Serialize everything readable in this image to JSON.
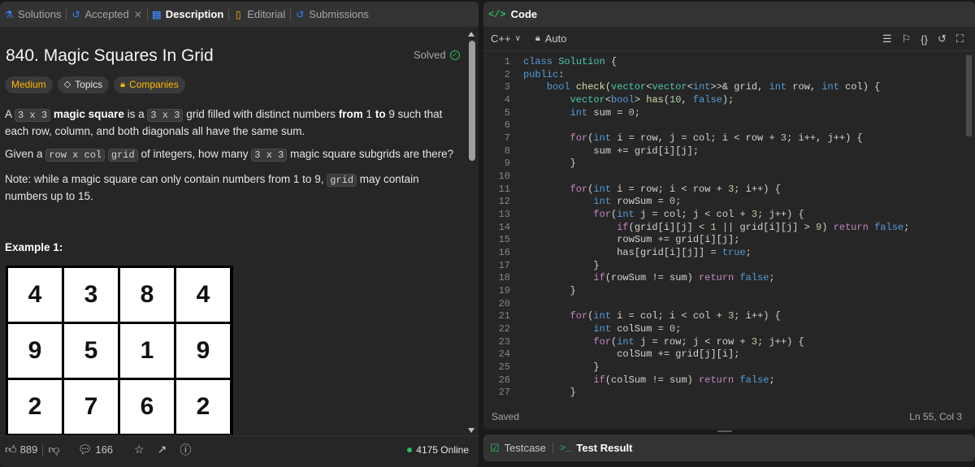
{
  "left_tabs": {
    "solutions": "Solutions",
    "accepted": "Accepted",
    "description": "Description",
    "editorial": "Editorial",
    "submissions": "Submissions"
  },
  "problem": {
    "title": "840. Magic Squares In Grid",
    "status": "Solved",
    "difficulty": "Medium",
    "topics_label": "Topics",
    "companies_label": "Companies",
    "desc": {
      "a": "A",
      "c3x3": "3 x 3",
      "magic": "magic square",
      "is_a": "is a",
      "grid_filled": "grid filled with distinct numbers",
      "from1": "from",
      "one": "1",
      "to": "to",
      "nine": "9",
      "rest": "such that each row, column, and both diagonals all have the same sum."
    },
    "q": {
      "given": "Given a",
      "rowxcol": "row x col",
      "grid": "grid",
      "of_int": "of integers, how many",
      "c3x3": "3 x 3",
      "rest": "magic square subgrids are there?"
    },
    "note": {
      "a": "Note: while a magic square can only contain numbers from 1 to 9,",
      "grid": "grid",
      "b": "may contain numbers up to 15."
    },
    "example_title": "Example 1:",
    "example_grid": [
      [
        "4",
        "3",
        "8",
        "4"
      ],
      [
        "9",
        "5",
        "1",
        "9"
      ],
      [
        "2",
        "7",
        "6",
        "2"
      ]
    ]
  },
  "left_footer": {
    "likes": "889",
    "comments": "166",
    "online": "4175 Online"
  },
  "code_panel": {
    "title": "Code",
    "language": "C++",
    "mode": "Auto",
    "status_saved": "Saved",
    "cursor": "Ln 55, Col 3",
    "lines": [
      {
        "n": "1"
      },
      {
        "n": "2"
      },
      {
        "n": "3"
      },
      {
        "n": "4"
      },
      {
        "n": "5"
      },
      {
        "n": "6"
      },
      {
        "n": "7"
      },
      {
        "n": "8"
      },
      {
        "n": "9"
      },
      {
        "n": "10"
      },
      {
        "n": "11"
      },
      {
        "n": "12"
      },
      {
        "n": "13"
      },
      {
        "n": "14"
      },
      {
        "n": "15"
      },
      {
        "n": "16"
      },
      {
        "n": "17"
      },
      {
        "n": "18"
      },
      {
        "n": "19"
      },
      {
        "n": "20"
      },
      {
        "n": "21"
      },
      {
        "n": "22"
      },
      {
        "n": "23"
      },
      {
        "n": "24"
      },
      {
        "n": "25"
      },
      {
        "n": "26"
      },
      {
        "n": "27"
      }
    ]
  },
  "bottom_tabs": {
    "testcase": "Testcase",
    "test_result": "Test Result"
  },
  "colors": {
    "accent_green": "#2cbb5d",
    "medium_yellow": "#ffb800",
    "panel_bg": "#262626",
    "tabbar_bg": "#333333"
  }
}
